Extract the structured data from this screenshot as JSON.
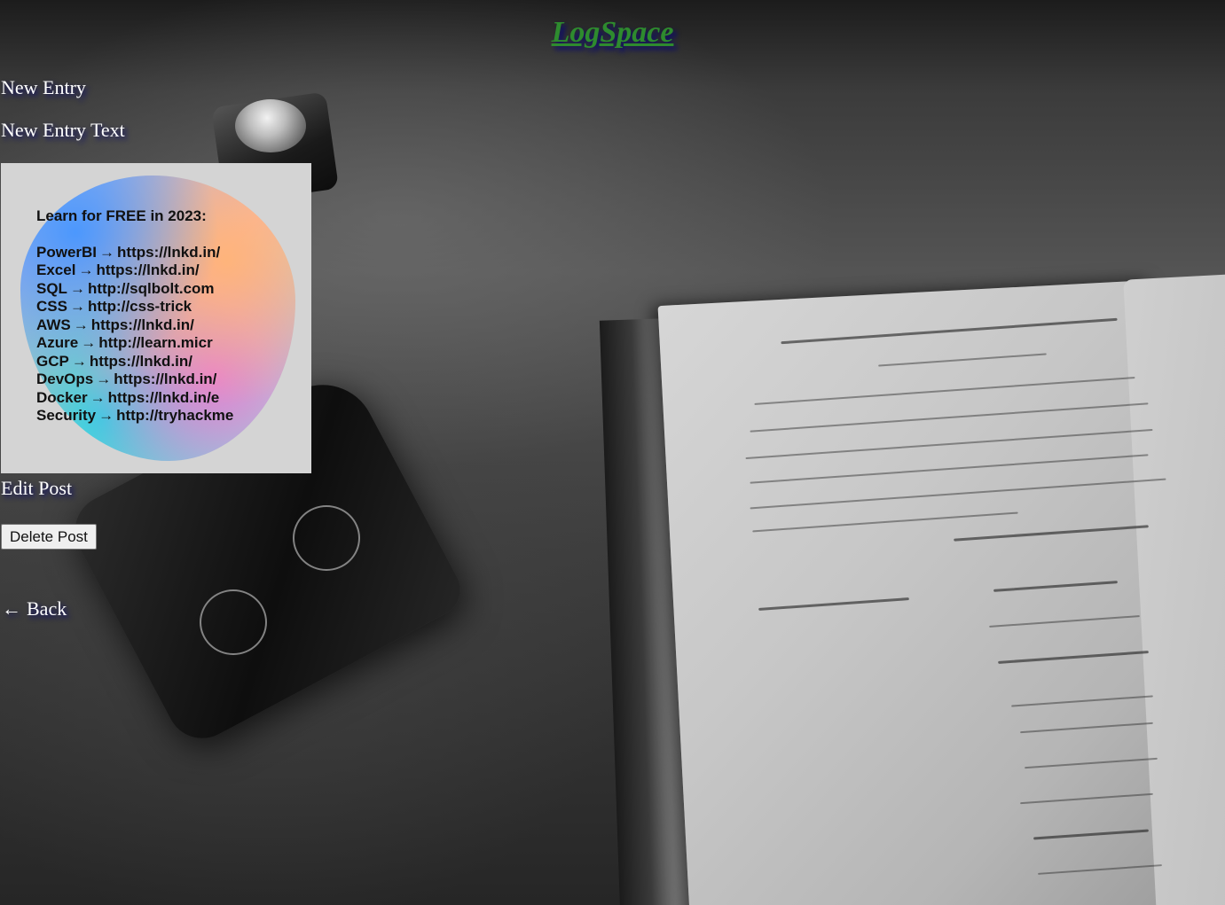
{
  "site": {
    "title": "LogSpace"
  },
  "entry": {
    "title": "New Entry",
    "text": "New Entry Text"
  },
  "post_image": {
    "heading": "Learn for FREE in 2023:",
    "arrow": "→",
    "lines": [
      {
        "name": "PowerBI",
        "url": "https://lnkd.in/"
      },
      {
        "name": "Excel",
        "url": "https://lnkd.in/"
      },
      {
        "name": "SQL",
        "url": "http://sqlbolt.com"
      },
      {
        "name": "CSS",
        "url": "http://css-trick"
      },
      {
        "name": "AWS",
        "url": "https://lnkd.in/"
      },
      {
        "name": "Azure",
        "url": "http://learn.micr"
      },
      {
        "name": "GCP",
        "url": "https://lnkd.in/"
      },
      {
        "name": "DevOps",
        "url": "https://lnkd.in/"
      },
      {
        "name": "Docker",
        "url": "https://lnkd.in/e"
      },
      {
        "name": "Security",
        "url": "http://tryhackme"
      }
    ]
  },
  "actions": {
    "edit_label": "Edit Post",
    "delete_label": "Delete Post",
    "back_label": "Back",
    "back_icon": "←"
  },
  "colors": {
    "title": "#2e8b2e",
    "text_shadow": "#0b0b6e",
    "text": "#ffffff"
  }
}
